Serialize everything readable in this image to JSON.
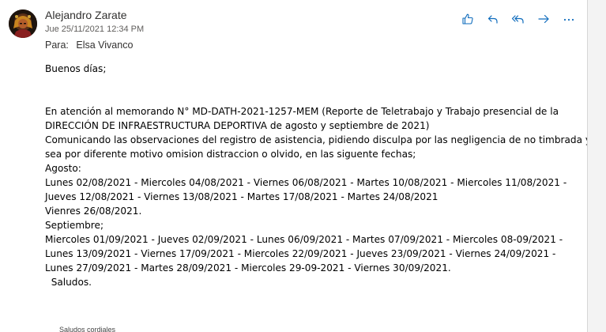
{
  "message": {
    "sender_name": "Alejandro Zarate",
    "datetime": "Jue 25/11/2021 12:34 PM",
    "to_label": "Para:",
    "to_name": "Elsa Vivanco",
    "accent_color": "#0f6cbd"
  },
  "actions": [
    {
      "name": "like",
      "icon": "thumbs-up-icon"
    },
    {
      "name": "reply",
      "icon": "reply-icon"
    },
    {
      "name": "reply-all",
      "icon": "reply-all-icon"
    },
    {
      "name": "forward",
      "icon": "forward-icon"
    },
    {
      "name": "more",
      "icon": "more-icon"
    }
  ],
  "body": {
    "greeting": "Buenos días;",
    "line_1": "En atención al memorando N° MD-DATH-2021-1257-MEM (Reporte de Teletrabajo y Trabajo presencial de la",
    "line_2": "DIRECCIÓN DE INFRAESTRUCTURA DEPORTIVA de agosto y septiembre de 2021)",
    "line_3": "Comunicando las observaciones del registro de asistencia, pidiendo disculpa por las negligencia de no timbrada ya",
    "line_4": "sea por diferente motivo omision distraccion o olvido, en las siguente fechas;",
    "august_label": "Agosto:",
    "august_1": "Lunes 02/08/2021 - Miercoles 04/08/2021 - Viernes 06/08/2021 - Martes 10/08/2021 - Miercoles 11/08/2021 -",
    "august_2": "Jueves 12/08/2021 - Viernes 13/08/2021 - Martes 17/08/2021 - Martes 24/08/2021",
    "august_3": "Vienres 26/08/2021.",
    "september_label": "Septiembre;",
    "september_1": "Miercoles 01/09/2021 - Jueves 02/09/2021 - Lunes 06/09/2021 - Martes 07/09/2021 - Miercoles 08-09/2021 -",
    "september_2": "Lunes 13/09/2021 - Viernes 17/09/2021 - Miercoles 22/09/2021 - Jueves 23/09/2021 -  Viernes 24/09/2021 -",
    "september_3": "Lunes 27/09/2021 - Martes 28/09/2021 - Miercoles 29-09-2021 - Viernes 30/09/2021.",
    "closing": "  Saludos.",
    "signature_partial": "Saludos cordiales"
  }
}
